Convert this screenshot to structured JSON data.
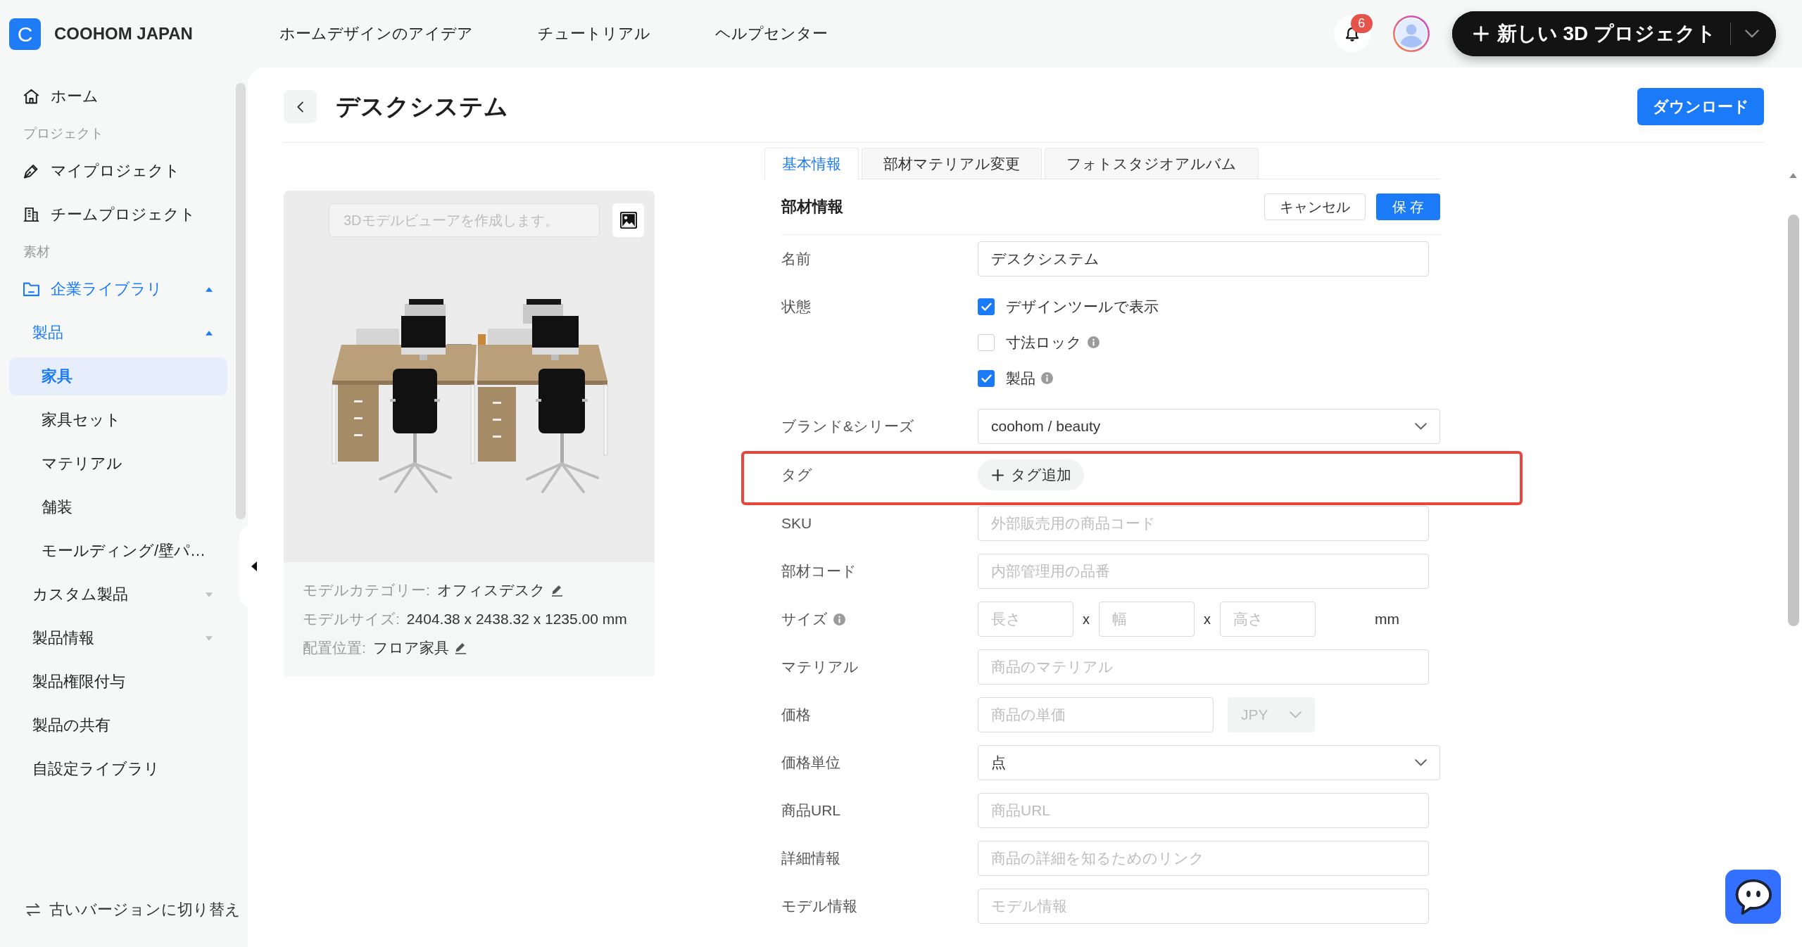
{
  "logo": {
    "mark": "C",
    "name": "COOHOM JAPAN"
  },
  "nav": [
    {
      "label": "ホームデザインのアイデア"
    },
    {
      "label": "チュートリアル"
    },
    {
      "label": "ヘルプセンター"
    }
  ],
  "notifications": {
    "count": "6"
  },
  "create_button": {
    "label": "新しい 3D プロジェクト"
  },
  "sidebar": {
    "items": [
      {
        "label": "ホーム",
        "selected": false
      }
    ],
    "sections": [
      {
        "title": "プロジェクト",
        "items": [
          {
            "label": "マイプロジェクト",
            "selected": false
          },
          {
            "label": "チームプロジェクト",
            "selected": false
          }
        ]
      },
      {
        "title": "素材",
        "items": [
          {
            "label": "企業ライブラリ",
            "selected": false,
            "expanded": true,
            "children": [
              {
                "label": "製品",
                "selected": false,
                "expanded": true,
                "children": [
                  {
                    "label": "家具",
                    "selected": true
                  },
                  {
                    "label": "家具セット",
                    "selected": false
                  },
                  {
                    "label": "マテリアル",
                    "selected": false
                  },
                  {
                    "label": "舗装",
                    "selected": false
                  },
                  {
                    "label": "モールディング/壁パ…",
                    "selected": false
                  }
                ]
              },
              {
                "label": "カスタム製品",
                "selected": false,
                "expanded": false
              },
              {
                "label": "製品情報",
                "selected": false,
                "expanded": false
              },
              {
                "label": "製品権限付与",
                "selected": false
              },
              {
                "label": "製品の共有",
                "selected": false
              },
              {
                "label": "自設定ライブラリ",
                "selected": false
              }
            ]
          }
        ]
      }
    ],
    "footer": {
      "label": "古いバージョンに切り替え"
    }
  },
  "page": {
    "title": "デスクシステム",
    "download_button": "ダウンロード"
  },
  "model": {
    "viewer_placeholder": "3Dモデルビューアを作成します。",
    "info": [
      {
        "label": "モデルカテゴリー:",
        "value": "オフィスデスク",
        "editable": true
      },
      {
        "label": "モデルサイズ:",
        "value": "2404.38 x 2438.32 x 1235.00 mm",
        "editable": false
      },
      {
        "label": "配置位置:",
        "value": "フロア家具",
        "editable": true
      }
    ]
  },
  "form": {
    "tabs": [
      {
        "label": "基本情報",
        "selected": true
      },
      {
        "label": "部材マテリアル変更",
        "selected": false
      },
      {
        "label": "フォトスタジオアルバム",
        "selected": false
      }
    ],
    "title": "部材情報",
    "cancel_button": "キャンセル",
    "save_button": "保 存",
    "fields": [
      {
        "kind": "text",
        "label": "名前",
        "value": "デスクシステム",
        "info": false,
        "highlighted": false
      },
      {
        "kind": "checks",
        "label": "状態",
        "info": false,
        "highlighted": false,
        "options": [
          {
            "label": "デザインツールで表示",
            "checked": true,
            "info": false
          },
          {
            "label": "寸法ロック",
            "checked": false,
            "info": true
          },
          {
            "label": "製品",
            "checked": true,
            "info": true
          }
        ]
      },
      {
        "kind": "select",
        "label": "ブランド&シリーズ",
        "value": "coohom / beauty",
        "info": false,
        "highlighted": false
      },
      {
        "kind": "tags",
        "label": "タグ",
        "button": "タグ追加",
        "info": false,
        "highlighted": true
      },
      {
        "kind": "text",
        "label": "SKU",
        "placeholder": "外部販売用の商品コード",
        "info": false,
        "highlighted": false
      },
      {
        "kind": "text",
        "label": "部材コード",
        "placeholder": "内部管理用の品番",
        "info": false,
        "highlighted": false
      },
      {
        "kind": "size",
        "label": "サイズ",
        "info": true,
        "highlighted": false,
        "inputs": [
          {
            "placeholder": "長さ"
          },
          {
            "placeholder": "幅"
          },
          {
            "placeholder": "高さ"
          }
        ],
        "separators": [
          "x",
          "x"
        ],
        "unit": "mm"
      },
      {
        "kind": "text",
        "label": "マテリアル",
        "placeholder": "商品のマテリアル",
        "info": false,
        "highlighted": false
      },
      {
        "kind": "price",
        "label": "価格",
        "placeholder": "商品の単価",
        "info": false,
        "highlighted": false,
        "currency": {
          "value": "JPY",
          "disabled": true
        }
      },
      {
        "kind": "select",
        "label": "価格単位",
        "value": "点",
        "info": false,
        "highlighted": false
      },
      {
        "kind": "text",
        "label": "商品URL",
        "placeholder": "商品URL",
        "info": false,
        "highlighted": false
      },
      {
        "kind": "text",
        "label": "詳細情報",
        "placeholder": "商品の詳細を知るためのリンク",
        "info": false,
        "highlighted": false
      },
      {
        "kind": "text",
        "label": "モデル情報",
        "placeholder": "モデル情報",
        "info": false,
        "highlighted": false
      }
    ]
  }
}
